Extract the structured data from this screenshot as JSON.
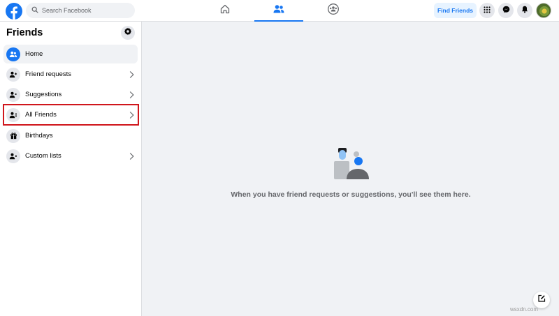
{
  "colors": {
    "brand_blue": "#1877f2",
    "page_bg": "#f0f2f5",
    "highlight_red": "#d0161c",
    "muted_text": "#65676b"
  },
  "header": {
    "logo_icon": "facebook-logo-icon",
    "search_placeholder": "Search Facebook",
    "tabs": [
      {
        "name": "home",
        "icon": "home-icon",
        "active": false
      },
      {
        "name": "friends",
        "icon": "friends-icon",
        "active": true
      },
      {
        "name": "groups",
        "icon": "groups-icon",
        "active": false
      }
    ],
    "find_friends_label": "Find Friends",
    "icons": [
      "menu-grid-icon",
      "messenger-icon",
      "notifications-bell-icon"
    ]
  },
  "sidebar": {
    "title": "Friends",
    "items": [
      {
        "label": "Home",
        "icon": "friends-home-icon",
        "active": true,
        "chevron": false
      },
      {
        "label": "Friend requests",
        "icon": "friend-request-icon",
        "active": false,
        "chevron": true
      },
      {
        "label": "Suggestions",
        "icon": "suggestions-icon",
        "active": false,
        "chevron": true
      },
      {
        "label": "All Friends",
        "icon": "all-friends-icon",
        "active": false,
        "chevron": true,
        "highlighted": true
      },
      {
        "label": "Birthdays",
        "icon": "gift-icon",
        "active": false,
        "chevron": false
      },
      {
        "label": "Custom lists",
        "icon": "custom-lists-icon",
        "active": false,
        "chevron": true
      }
    ]
  },
  "main": {
    "empty_message": "When you have friend requests or suggestions, you'll see them here."
  },
  "watermark": "wsxdn.com"
}
